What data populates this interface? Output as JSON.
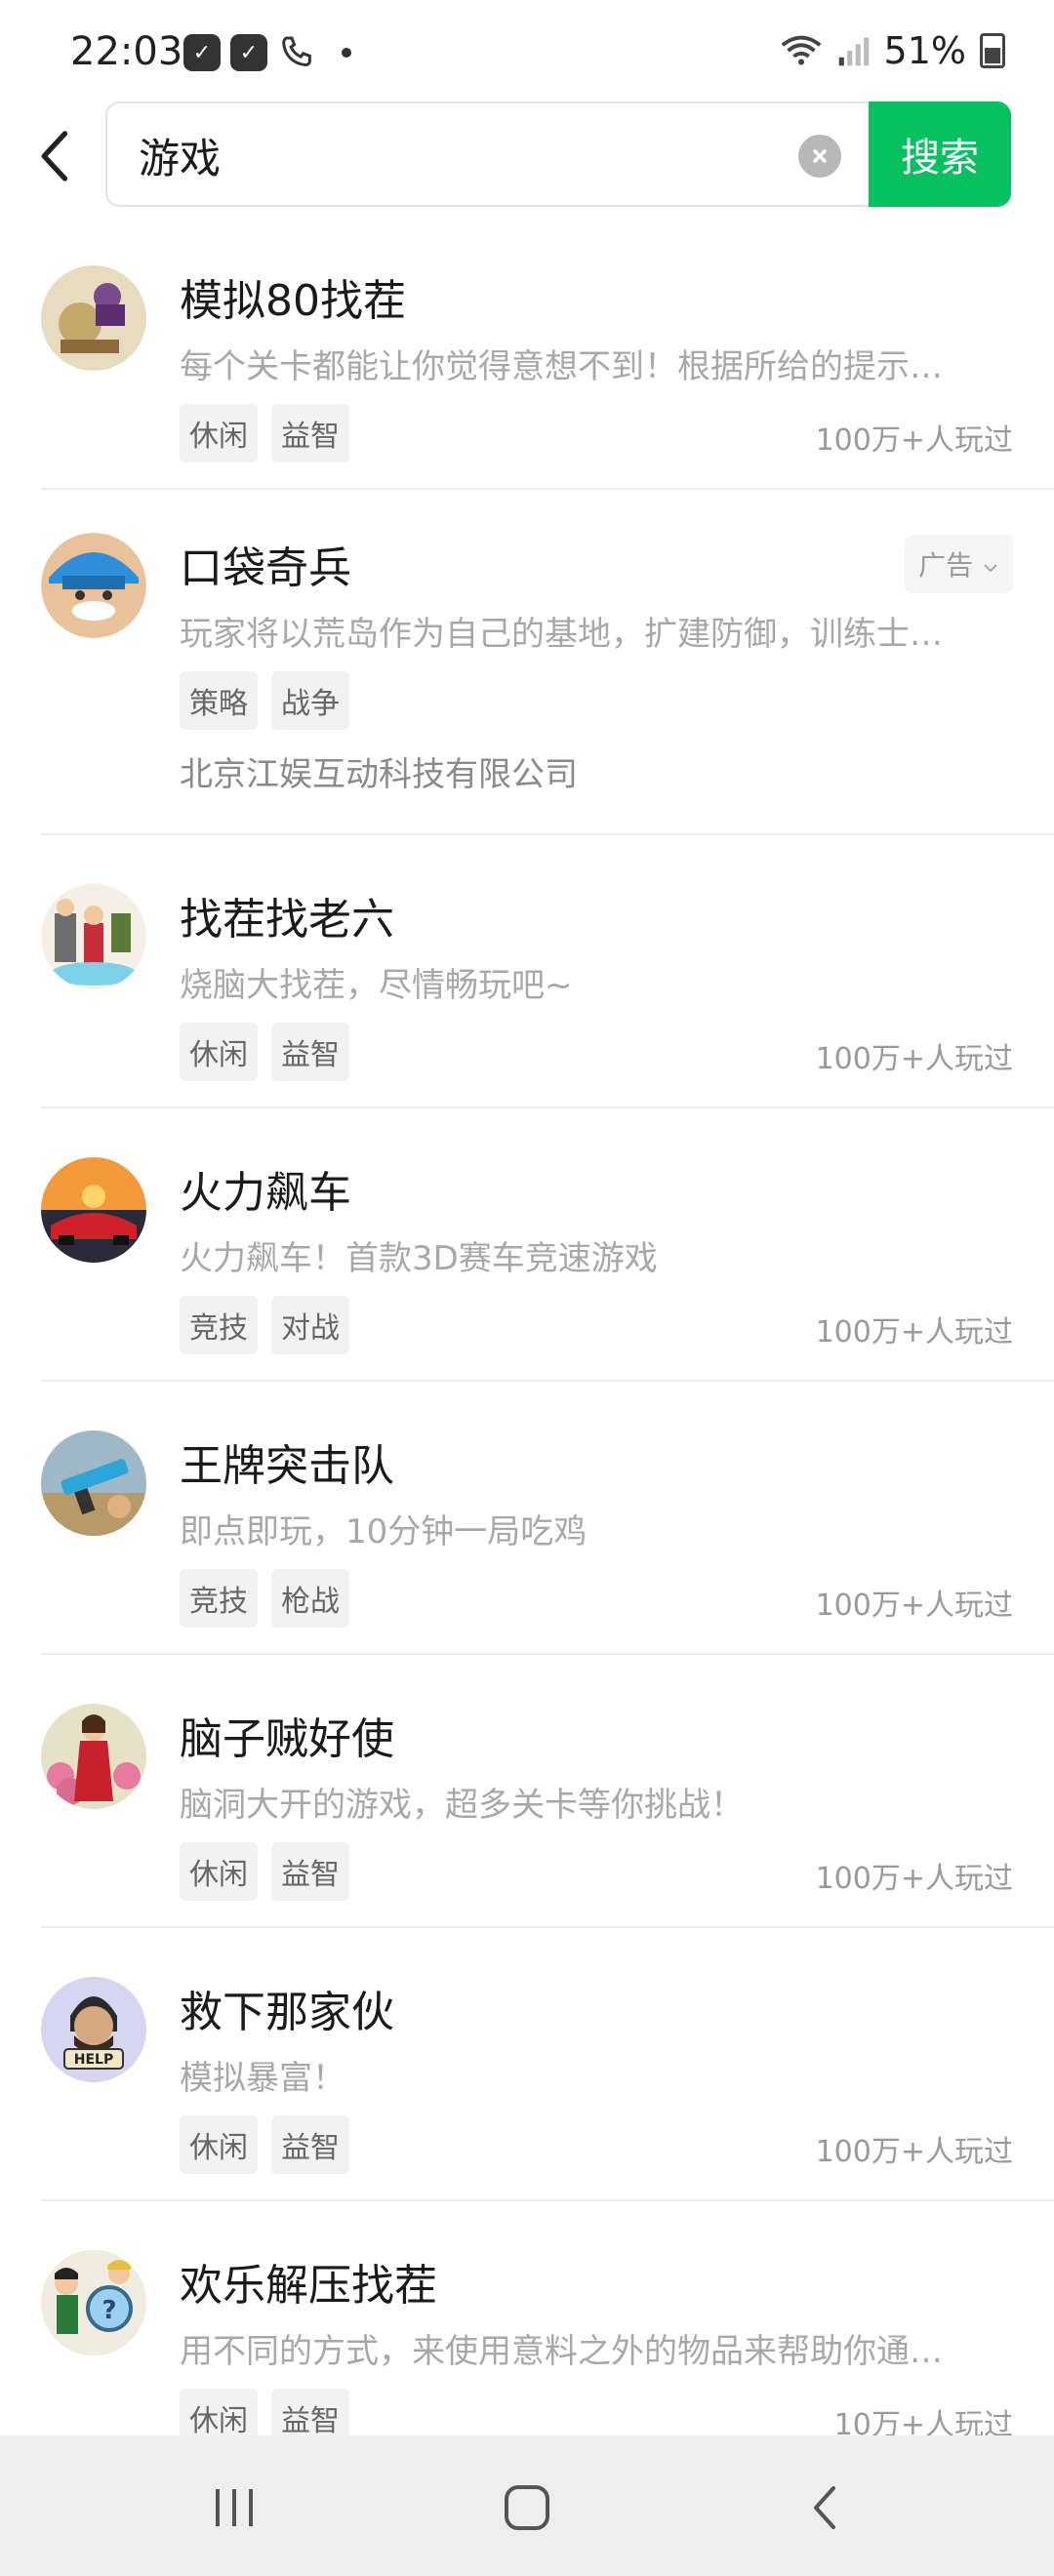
{
  "status_bar": {
    "time": "22:03",
    "battery": "51%"
  },
  "search": {
    "query": "游戏",
    "button_label": "搜索"
  },
  "results": [
    {
      "title": "模拟80找茬",
      "desc": "每个关卡都能让你觉得意想不到！根据所给的提示…",
      "tags": [
        "休闲",
        "益智"
      ],
      "plays": "100万+人玩过"
    },
    {
      "title": "口袋奇兵",
      "desc": "玩家将以荒岛作为自己的基地，扩建防御，训练士…",
      "tags": [
        "策略",
        "战争"
      ],
      "ad_label": "广告",
      "company": "北京江娱互动科技有限公司"
    },
    {
      "title": "找茬找老六",
      "desc": "烧脑大找茬，尽情畅玩吧~",
      "tags": [
        "休闲",
        "益智"
      ],
      "plays": "100万+人玩过"
    },
    {
      "title": "火力飙车",
      "desc": "火力飙车！首款3D赛车竞速游戏",
      "tags": [
        "竞技",
        "对战"
      ],
      "plays": "100万+人玩过"
    },
    {
      "title": "王牌突击队",
      "desc": "即点即玩，10分钟一局吃鸡",
      "tags": [
        "竞技",
        "枪战"
      ],
      "plays": "100万+人玩过"
    },
    {
      "title": "脑子贼好使",
      "desc": "脑洞大开的游戏，超多关卡等你挑战！",
      "tags": [
        "休闲",
        "益智"
      ],
      "plays": "100万+人玩过"
    },
    {
      "title": "救下那家伙",
      "desc": "模拟暴富！",
      "tags": [
        "休闲",
        "益智"
      ],
      "plays": "100万+人玩过",
      "avatar_text": "HELP"
    },
    {
      "title": "欢乐解压找茬",
      "desc": "用不同的方式，来使用意料之外的物品来帮助你通…",
      "tags": [
        "休闲",
        "益智"
      ],
      "plays": "10万+人玩过"
    }
  ],
  "colors": {
    "accent": "#07c160"
  }
}
